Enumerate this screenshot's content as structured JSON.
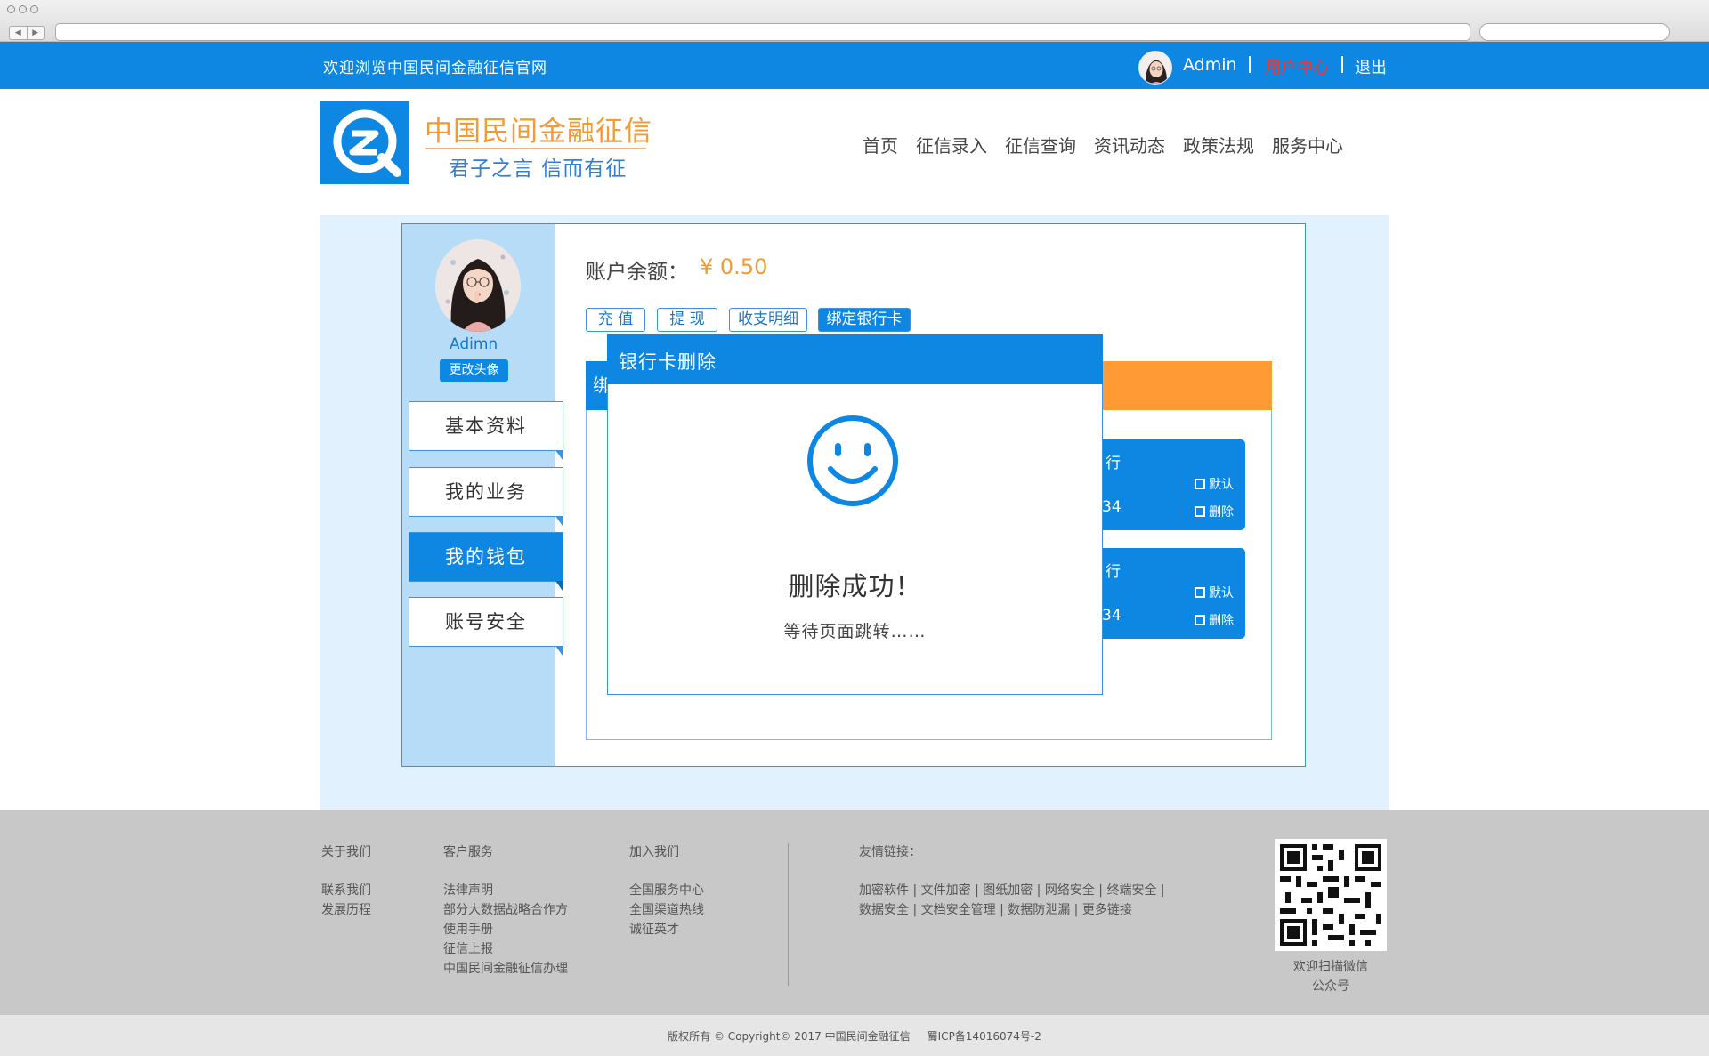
{
  "topbar": {
    "welcome": "欢迎浏览中国民间金融征信官网",
    "username": "Admin",
    "user_center": "用户中心",
    "logout": "退出"
  },
  "header": {
    "logo_title": "中国民间金融征信",
    "logo_slogan": "君子之言 信而有征",
    "nav": [
      "首页",
      "征信录入",
      "征信查询",
      "资讯动态",
      "政策法规",
      "服务中心"
    ]
  },
  "sidebar": {
    "name": "Adimn",
    "change_avatar": "更改头像",
    "menu": [
      "基本资料",
      "我的业务",
      "我的钱包",
      "账号安全"
    ],
    "active_index": 2
  },
  "wallet": {
    "balance_label": "账户余额：",
    "balance_value": "¥ 0.50",
    "tabs": [
      "充 值",
      "提 现",
      "收支明细",
      "绑定银行卡"
    ],
    "active_tab": 3,
    "card_header_fragment": "绑",
    "cards": [
      {
        "title_fragment": "行",
        "number_fragment": "34",
        "default_label": "默认",
        "delete_label": "删除"
      },
      {
        "title_fragment": "行",
        "number_fragment": "34",
        "default_label": "默认",
        "delete_label": "删除"
      }
    ]
  },
  "modal": {
    "title": "银行卡删除",
    "message": "删除成功！",
    "sub": "等待页面跳转……",
    "icon": "smiley-icon"
  },
  "footer": {
    "about": {
      "heading": "关于我们",
      "items": [
        "联系我们",
        "发展历程"
      ]
    },
    "service": {
      "heading": "客户服务",
      "items": [
        "法律声明",
        "部分大数据战略合作方",
        "使用手册",
        "征信上报",
        "中国民间金融征信办理"
      ]
    },
    "join": {
      "heading": "加入我们",
      "items": [
        "全国服务中心",
        "全国渠道热线",
        "诚征英才"
      ]
    },
    "links": {
      "heading": "友情链接：",
      "line1": "加密软件 | 文件加密 | 图纸加密 | 网络安全 | 终端安全 |",
      "line2": "数据安全 | 文档安全管理 | 数据防泄漏 | 更多链接"
    },
    "qr_caption_1": "欢迎扫描微信",
    "qr_caption_2": "公众号",
    "copyright": "版权所有 © Copyright© 2017 中国民间金融征信     蜀ICP备14016074号-2"
  },
  "colors": {
    "primary": "#0e87e3",
    "accent": "#f39a32",
    "orange": "#ff9a34",
    "footer": "#c8c8c8"
  }
}
